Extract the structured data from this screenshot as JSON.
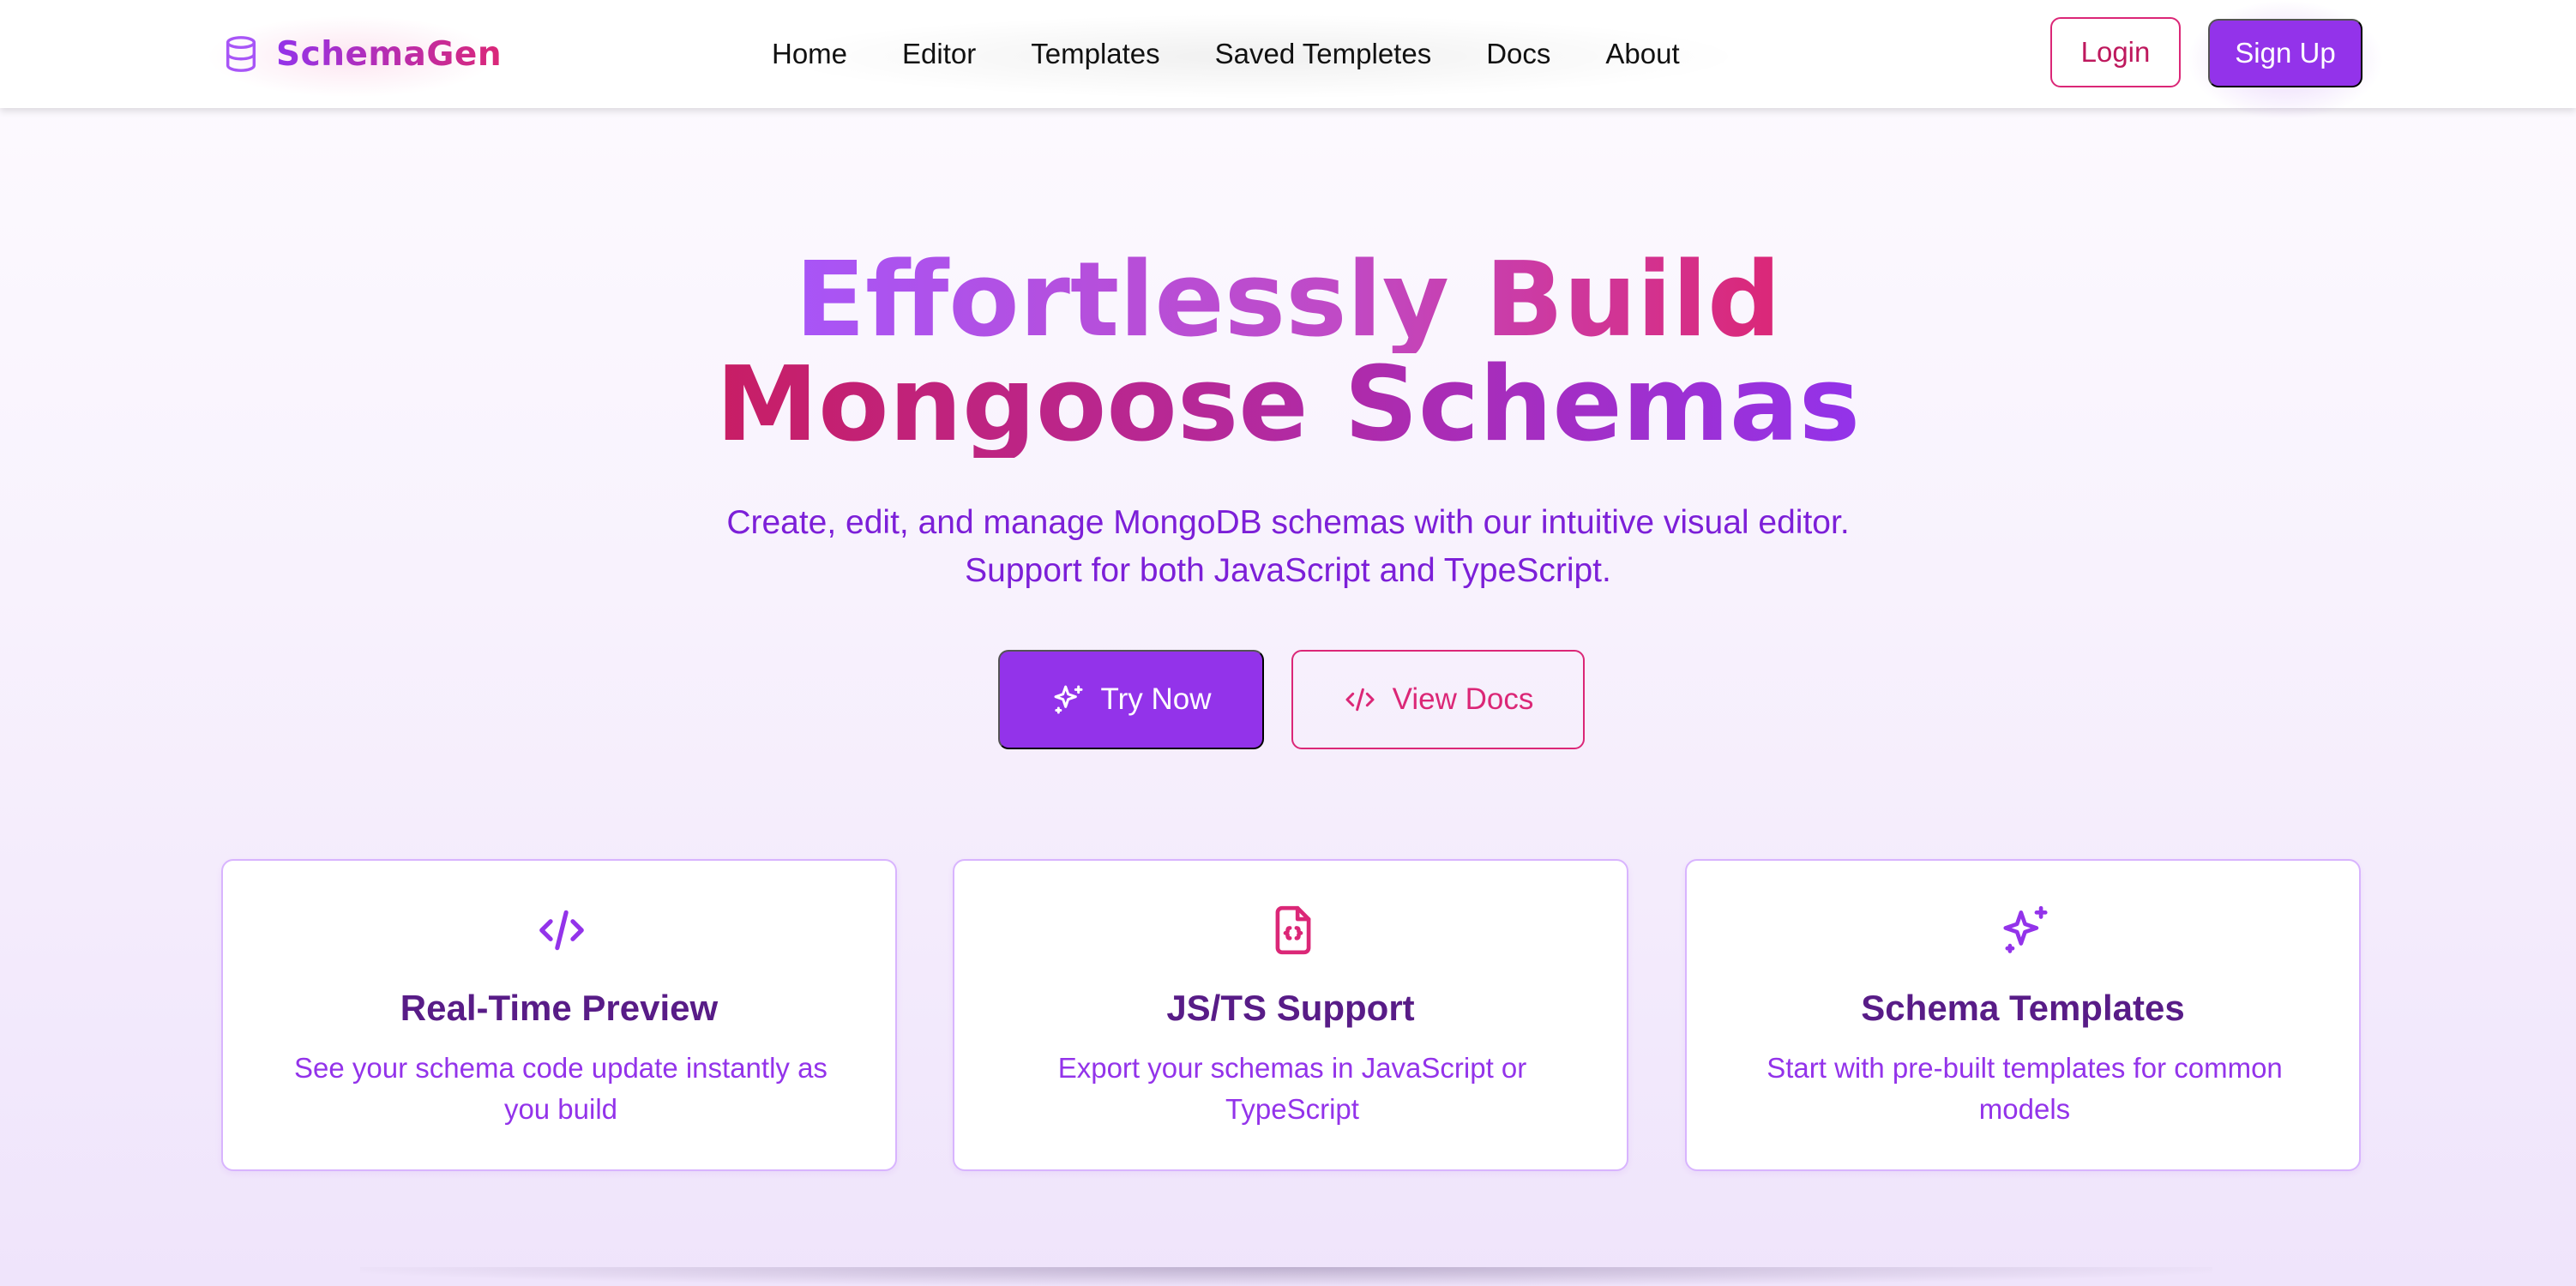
{
  "brand": {
    "name": "SchemaGen",
    "icon": "database-icon"
  },
  "nav": {
    "links": [
      "Home",
      "Editor",
      "Templates",
      "Saved Templetes",
      "Docs",
      "About"
    ],
    "login_label": "Login",
    "signup_label": "Sign Up"
  },
  "hero": {
    "title_line1": "Effortlessly Build",
    "title_line2": "Mongoose Schemas",
    "subtitle_line1": "Create, edit, and manage MongoDB schemas with our intuitive visual editor.",
    "subtitle_line2": "Support for both JavaScript and TypeScript.",
    "primary_cta": {
      "label": "Try Now",
      "icon": "sparkles-icon"
    },
    "secondary_cta": {
      "label": "View Docs",
      "icon": "code-icon"
    }
  },
  "features": [
    {
      "icon": "code-icon",
      "title": "Real-Time Preview",
      "description": "See your schema code update instantly as you build"
    },
    {
      "icon": "file-code-icon",
      "title": "JS/TS Support",
      "description": "Export your schemas in JavaScript or TypeScript"
    },
    {
      "icon": "sparkles-icon",
      "title": "Schema Templates",
      "description": "Start with pre-built templates for common models"
    }
  ],
  "colors": {
    "primary": "#9333ea",
    "accent": "#db2777",
    "text_purple": "#581c87"
  }
}
